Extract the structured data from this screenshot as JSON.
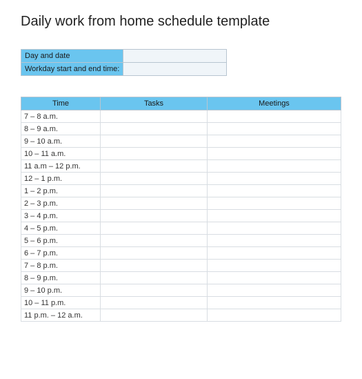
{
  "title": "Daily work from home schedule template",
  "info": {
    "rows": [
      {
        "label": "Day and date",
        "value": ""
      },
      {
        "label": "Workday start and end time:",
        "value": ""
      }
    ]
  },
  "schedule": {
    "headers": {
      "time": "Time",
      "tasks": "Tasks",
      "meetings": "Meetings"
    },
    "rows": [
      {
        "time": "7 – 8 a.m.",
        "tasks": "",
        "meetings": ""
      },
      {
        "time": "8 – 9 a.m.",
        "tasks": "",
        "meetings": ""
      },
      {
        "time": "9 – 10 a.m.",
        "tasks": "",
        "meetings": ""
      },
      {
        "time": "10 – 11 a.m.",
        "tasks": "",
        "meetings": ""
      },
      {
        "time": "11 a.m – 12 p.m.",
        "tasks": "",
        "meetings": ""
      },
      {
        "time": "12 – 1 p.m.",
        "tasks": "",
        "meetings": ""
      },
      {
        "time": "1 – 2 p.m.",
        "tasks": "",
        "meetings": ""
      },
      {
        "time": "2 – 3 p.m.",
        "tasks": "",
        "meetings": ""
      },
      {
        "time": "3 – 4 p.m.",
        "tasks": "",
        "meetings": ""
      },
      {
        "time": "4 – 5 p.m.",
        "tasks": "",
        "meetings": ""
      },
      {
        "time": "5 – 6 p.m.",
        "tasks": "",
        "meetings": ""
      },
      {
        "time": "6 – 7 p.m.",
        "tasks": "",
        "meetings": ""
      },
      {
        "time": "7 – 8 p.m.",
        "tasks": "",
        "meetings": ""
      },
      {
        "time": "8 – 9 p.m.",
        "tasks": "",
        "meetings": ""
      },
      {
        "time": "9 – 10 p.m.",
        "tasks": "",
        "meetings": ""
      },
      {
        "time": "10 – 11 p.m.",
        "tasks": "",
        "meetings": ""
      },
      {
        "time": "11 p.m. – 12 a.m.",
        "tasks": "",
        "meetings": ""
      }
    ]
  }
}
